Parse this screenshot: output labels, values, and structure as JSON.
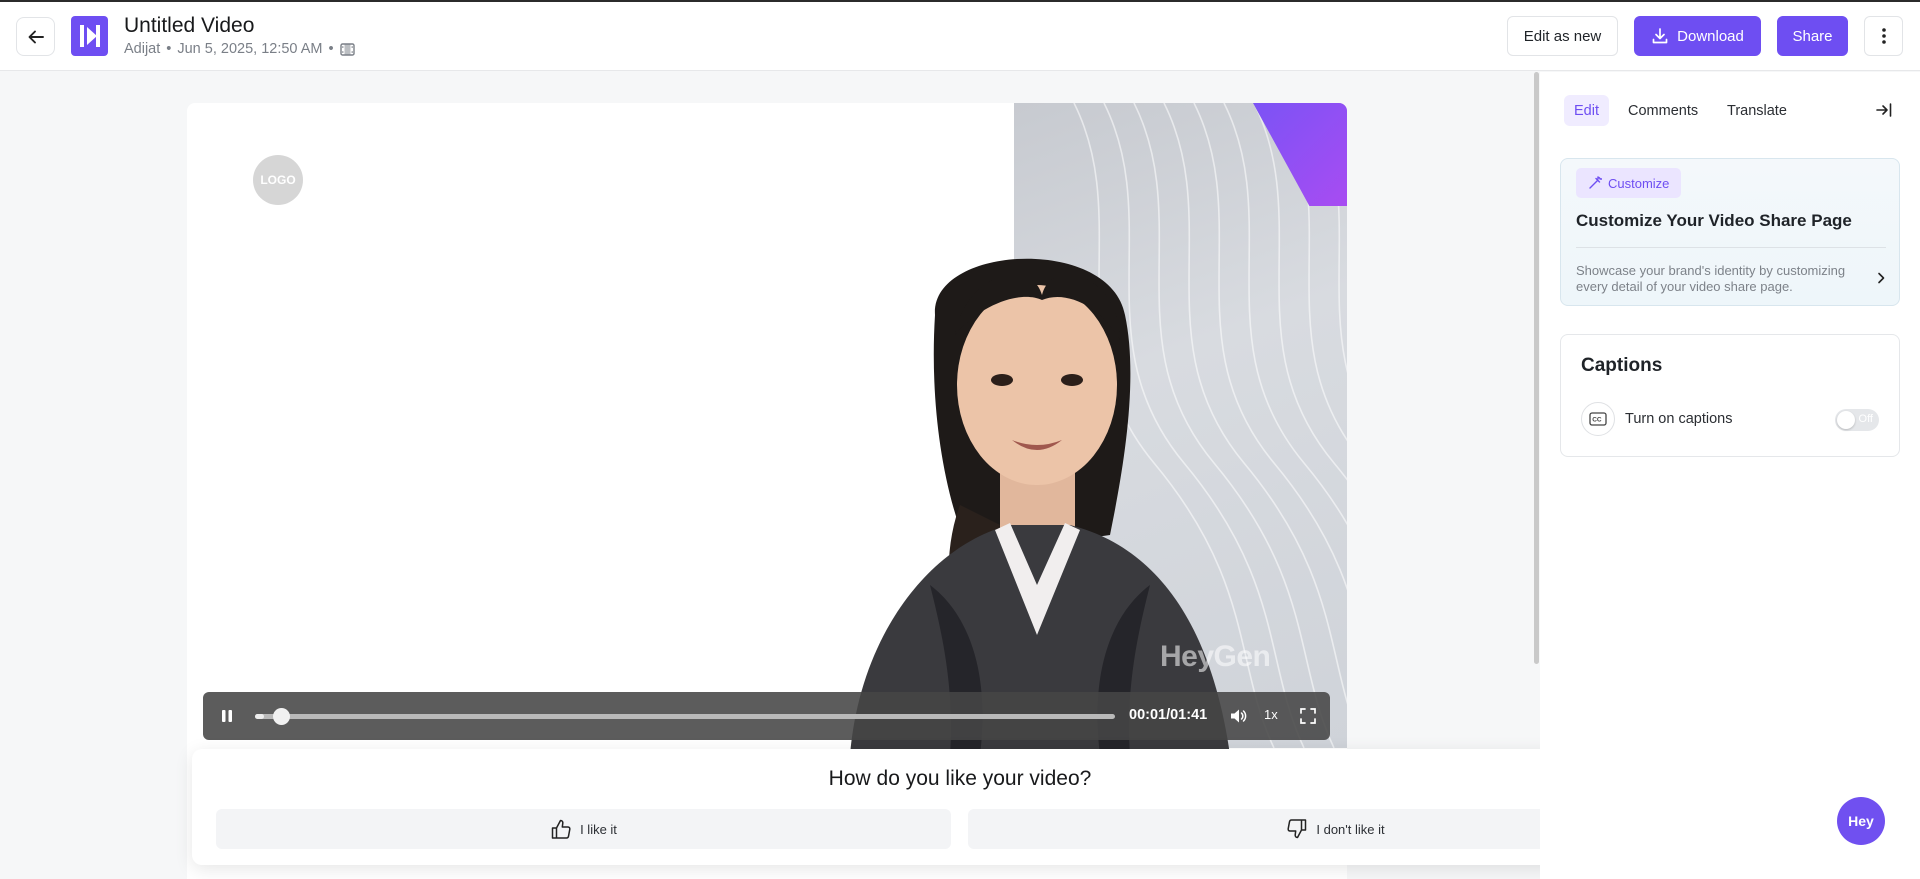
{
  "header": {
    "title": "Untitled Video",
    "author": "Adijat",
    "date": "Jun 5, 2025, 12:50 AM",
    "edit_as_new_label": "Edit as new",
    "download_label": "Download",
    "share_label": "Share"
  },
  "video": {
    "logo_placeholder": "LOGO",
    "watermark": "HeyGen",
    "time_display": "00:01/01:41",
    "progress_fraction": 0.01,
    "speed": "1x"
  },
  "feedback": {
    "title": "How do you like your video?",
    "like_label": "I like it",
    "dislike_label": "I don't like it"
  },
  "panel": {
    "tabs": [
      {
        "label": "Edit",
        "active": true
      },
      {
        "label": "Comments",
        "active": false
      },
      {
        "label": "Translate",
        "active": false
      }
    ],
    "customize": {
      "badge": "Customize",
      "title": "Customize Your Video Share Page",
      "description": "Showcase your brand's identity by customizing every detail of your video share page."
    },
    "captions": {
      "title": "Captions",
      "label": "Turn on captions",
      "toggle_text": "Off",
      "enabled": false
    }
  },
  "chat_bubble": "Hey",
  "colors": {
    "brand": "#6e4ef2",
    "panel_tab_active_bg": "#f0ecff"
  }
}
